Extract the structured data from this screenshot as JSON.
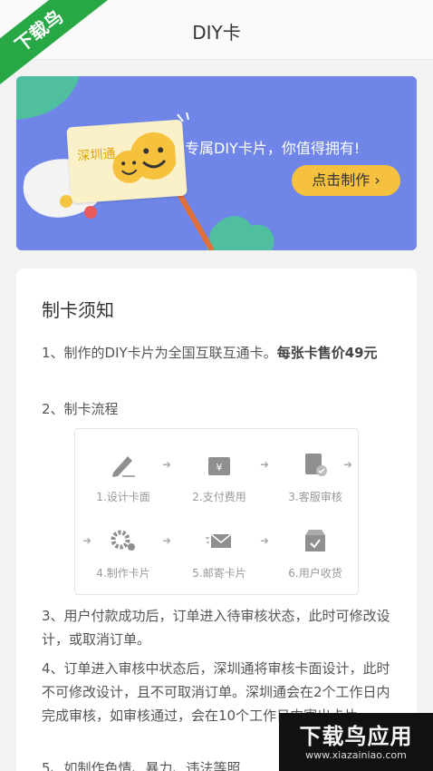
{
  "header": {
    "title": "DIY卡"
  },
  "watermark_top": "下载鸟",
  "banner": {
    "card_text": "深圳通",
    "slogan": "专属DIY卡片，你值得拥有!",
    "button": "点击制作"
  },
  "notice": {
    "title": "制卡须知",
    "item1_text": "1、制作的DIY卡片为全国互联互通卡。",
    "item1_bold": "每张卡售价49元",
    "item2": "2、制卡流程",
    "steps": [
      "1.设计卡面",
      "2.支付费用",
      "3.客服审核",
      "4.制作卡片",
      "5.邮寄卡片",
      "6.用户收货"
    ],
    "item3": "3、用户付款成功后，订单进入待审核状态，此时可修改设计，或取消订单。",
    "item4": "4、订单进入审核中状态后，深圳通将审核卡面设计，此时不可修改设计，且不可取消订单。深圳通会在2个工作日内完成审核，如审核通过，会在10个工作日内寄出卡片。",
    "item5": "5、如制作色情、暴力、违法等照"
  },
  "watermark_bottom": {
    "title": "下载鸟应用",
    "url": "www.xiazainiao.com"
  },
  "colors": {
    "banner": "#6f86e8",
    "button": "#f5c13e",
    "watermark_green": "#27a844"
  }
}
